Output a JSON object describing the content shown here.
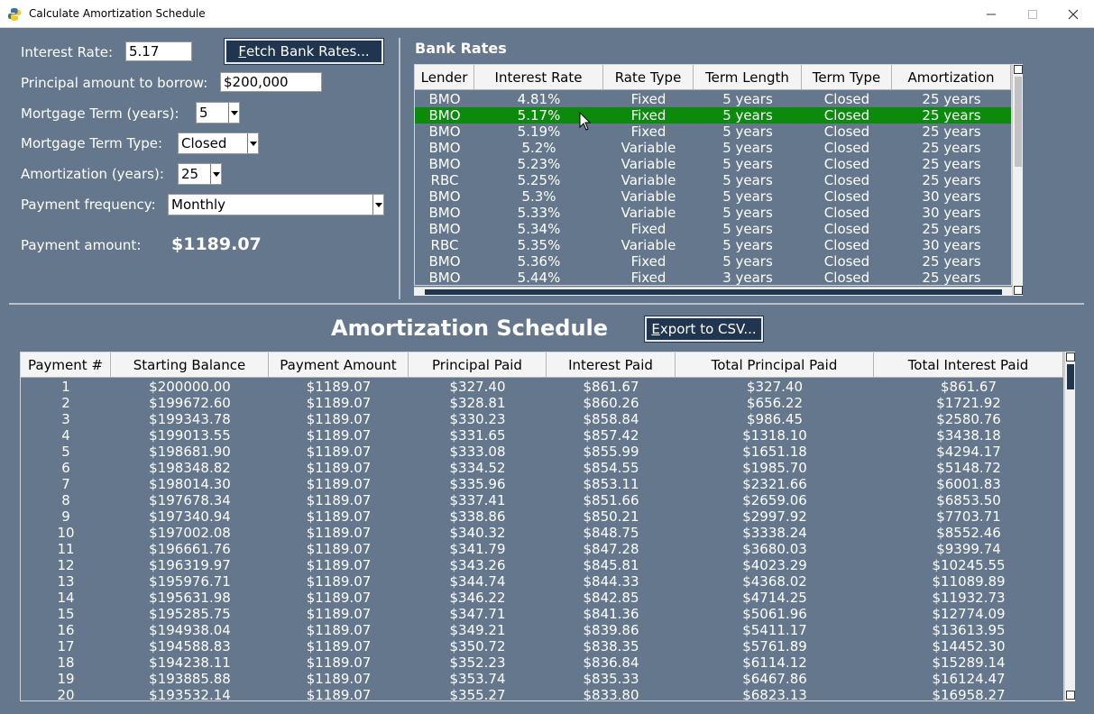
{
  "window": {
    "title": "Calculate Amortization Schedule",
    "icon": "python-icon"
  },
  "form": {
    "interest_rate_label": "Interest Rate:",
    "interest_rate_value": "5.17",
    "fetch_button": "Fetch Bank Rates...",
    "fetch_button_mnemonic": "F",
    "fetch_button_rest": "etch Bank Rates...",
    "principal_label": "Principal amount to borrow:",
    "principal_value": "$200,000",
    "term_label": "Mortgage Term (years):",
    "term_value": "5",
    "term_type_label": "Mortgage Term Type:",
    "term_type_value": "Closed",
    "amortization_label": "Amortization (years):",
    "amortization_value": "25",
    "frequency_label": "Payment frequency:",
    "frequency_value": "Monthly",
    "payment_label": "Payment amount:",
    "payment_value": "$1189.07"
  },
  "bank_rates": {
    "title": "Bank Rates",
    "columns": [
      "Lender",
      "Interest Rate",
      "Rate Type",
      "Term Length",
      "Term Type",
      "Amortization"
    ],
    "selected_row_index": 1,
    "rows": [
      [
        "BMO",
        "4.81%",
        "Fixed",
        "5 years",
        "Closed",
        "25 years"
      ],
      [
        "BMO",
        "5.17%",
        "Fixed",
        "5 years",
        "Closed",
        "25 years"
      ],
      [
        "BMO",
        "5.19%",
        "Fixed",
        "5 years",
        "Closed",
        "25 years"
      ],
      [
        "BMO",
        "5.2%",
        "Variable",
        "5 years",
        "Closed",
        "25 years"
      ],
      [
        "BMO",
        "5.23%",
        "Variable",
        "5 years",
        "Closed",
        "25 years"
      ],
      [
        "RBC",
        "5.25%",
        "Variable",
        "5 years",
        "Closed",
        "25 years"
      ],
      [
        "BMO",
        "5.3%",
        "Variable",
        "5 years",
        "Closed",
        "30 years"
      ],
      [
        "BMO",
        "5.33%",
        "Variable",
        "5 years",
        "Closed",
        "30 years"
      ],
      [
        "BMO",
        "5.34%",
        "Fixed",
        "5 years",
        "Closed",
        "25 years"
      ],
      [
        "RBC",
        "5.35%",
        "Variable",
        "5 years",
        "Closed",
        "30 years"
      ],
      [
        "BMO",
        "5.36%",
        "Fixed",
        "5 years",
        "Closed",
        "25 years"
      ],
      [
        "BMO",
        "5.44%",
        "Fixed",
        "3 years",
        "Closed",
        "25 years"
      ]
    ]
  },
  "schedule": {
    "title": "Amortization Schedule",
    "export_button": "Export to CSV...",
    "export_button_mnemonic": "E",
    "export_button_rest": "xport to CSV...",
    "columns": [
      "Payment #",
      "Starting Balance",
      "Payment Amount",
      "Principal Paid",
      "Interest Paid",
      "Total Principal Paid",
      "Total Interest Paid"
    ],
    "rows": [
      [
        "1",
        "$200000.00",
        "$1189.07",
        "$327.40",
        "$861.67",
        "$327.40",
        "$861.67"
      ],
      [
        "2",
        "$199672.60",
        "$1189.07",
        "$328.81",
        "$860.26",
        "$656.22",
        "$1721.92"
      ],
      [
        "3",
        "$199343.78",
        "$1189.07",
        "$330.23",
        "$858.84",
        "$986.45",
        "$2580.76"
      ],
      [
        "4",
        "$199013.55",
        "$1189.07",
        "$331.65",
        "$857.42",
        "$1318.10",
        "$3438.18"
      ],
      [
        "5",
        "$198681.90",
        "$1189.07",
        "$333.08",
        "$855.99",
        "$1651.18",
        "$4294.17"
      ],
      [
        "6",
        "$198348.82",
        "$1189.07",
        "$334.52",
        "$854.55",
        "$1985.70",
        "$5148.72"
      ],
      [
        "7",
        "$198014.30",
        "$1189.07",
        "$335.96",
        "$853.11",
        "$2321.66",
        "$6001.83"
      ],
      [
        "8",
        "$197678.34",
        "$1189.07",
        "$337.41",
        "$851.66",
        "$2659.06",
        "$6853.50"
      ],
      [
        "9",
        "$197340.94",
        "$1189.07",
        "$338.86",
        "$850.21",
        "$2997.92",
        "$7703.71"
      ],
      [
        "10",
        "$197002.08",
        "$1189.07",
        "$340.32",
        "$848.75",
        "$3338.24",
        "$8552.46"
      ],
      [
        "11",
        "$196661.76",
        "$1189.07",
        "$341.79",
        "$847.28",
        "$3680.03",
        "$9399.74"
      ],
      [
        "12",
        "$196319.97",
        "$1189.07",
        "$343.26",
        "$845.81",
        "$4023.29",
        "$10245.55"
      ],
      [
        "13",
        "$195976.71",
        "$1189.07",
        "$344.74",
        "$844.33",
        "$4368.02",
        "$11089.89"
      ],
      [
        "14",
        "$195631.98",
        "$1189.07",
        "$346.22",
        "$842.85",
        "$4714.25",
        "$11932.73"
      ],
      [
        "15",
        "$195285.75",
        "$1189.07",
        "$347.71",
        "$841.36",
        "$5061.96",
        "$12774.09"
      ],
      [
        "16",
        "$194938.04",
        "$1189.07",
        "$349.21",
        "$839.86",
        "$5411.17",
        "$13613.95"
      ],
      [
        "17",
        "$194588.83",
        "$1189.07",
        "$350.72",
        "$838.35",
        "$5761.89",
        "$14452.30"
      ],
      [
        "18",
        "$194238.11",
        "$1189.07",
        "$352.23",
        "$836.84",
        "$6114.12",
        "$15289.14"
      ],
      [
        "19",
        "$193885.88",
        "$1189.07",
        "$353.74",
        "$835.33",
        "$6467.86",
        "$16124.47"
      ],
      [
        "20",
        "$193532.14",
        "$1189.07",
        "$355.27",
        "$833.80",
        "$6823.13",
        "$16958.27"
      ]
    ]
  },
  "colors": {
    "background": "#64778d",
    "selected_row": "#0b8a0b",
    "button": "#1f3550"
  }
}
